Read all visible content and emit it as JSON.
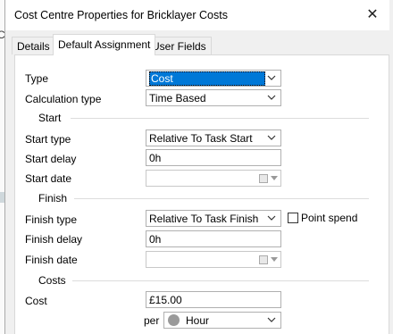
{
  "window": {
    "title": "Cost Centre Properties for Bricklayer Costs"
  },
  "tabs": [
    {
      "label": "Details"
    },
    {
      "label": "Default Assignment"
    },
    {
      "label": "User Fields"
    }
  ],
  "form": {
    "type": {
      "label": "Type",
      "value": "Cost"
    },
    "calculation_type": {
      "label": "Calculation type",
      "value": "Time Based"
    },
    "sections": {
      "start": "Start",
      "finish": "Finish",
      "costs": "Costs"
    },
    "start_type": {
      "label": "Start type",
      "value": "Relative To Task Start"
    },
    "start_delay": {
      "label": "Start delay",
      "value": "0h"
    },
    "start_date": {
      "label": "Start date",
      "value": ""
    },
    "finish_type": {
      "label": "Finish type",
      "value": "Relative To Task Finish"
    },
    "point_spend": {
      "label": "Point spend",
      "checked": false
    },
    "finish_delay": {
      "label": "Finish delay",
      "value": "0h"
    },
    "finish_date": {
      "label": "Finish date",
      "value": ""
    },
    "cost": {
      "label": "Cost",
      "value": "£15.00"
    },
    "per": {
      "label": "per",
      "value": "Hour"
    }
  },
  "background_fragment": "C"
}
